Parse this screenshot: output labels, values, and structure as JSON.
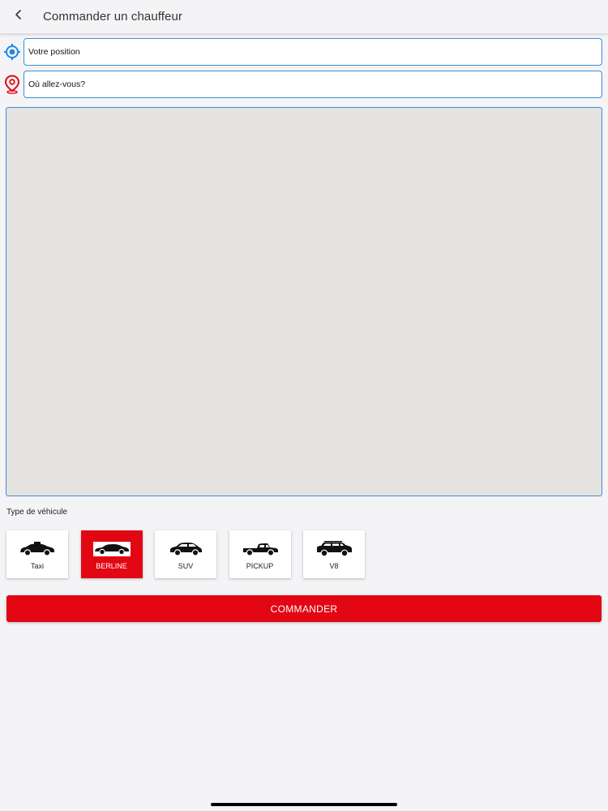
{
  "header": {
    "title": "Commander un chauffeur",
    "back_icon": "chevron-left-icon"
  },
  "origin": {
    "icon": "locate-icon",
    "icon_color": "#1e88e5",
    "placeholder": "Votre position"
  },
  "destination": {
    "icon": "map-pin-icon",
    "icon_color": "#e30613",
    "placeholder": "Où allez-vous?"
  },
  "map": {
    "background": "#e5e3df"
  },
  "vehicles": {
    "label": "Type de véhicule",
    "items": [
      {
        "name": "Taxi",
        "icon": "taxi-icon",
        "selected": false
      },
      {
        "name": "BERLINE",
        "icon": "sedan-icon",
        "selected": true
      },
      {
        "name": "SUV",
        "icon": "suv-icon",
        "selected": false
      },
      {
        "name": "PICKUP",
        "icon": "pickup-icon",
        "selected": false
      },
      {
        "name": "V8",
        "icon": "v8-suv-icon",
        "selected": false
      }
    ]
  },
  "order_button": {
    "label": "COMMANDER",
    "color": "#e30613"
  },
  "colors": {
    "accent": "#e30613",
    "focus_border": "#3f8bd8",
    "background": "#f4f4f6"
  }
}
